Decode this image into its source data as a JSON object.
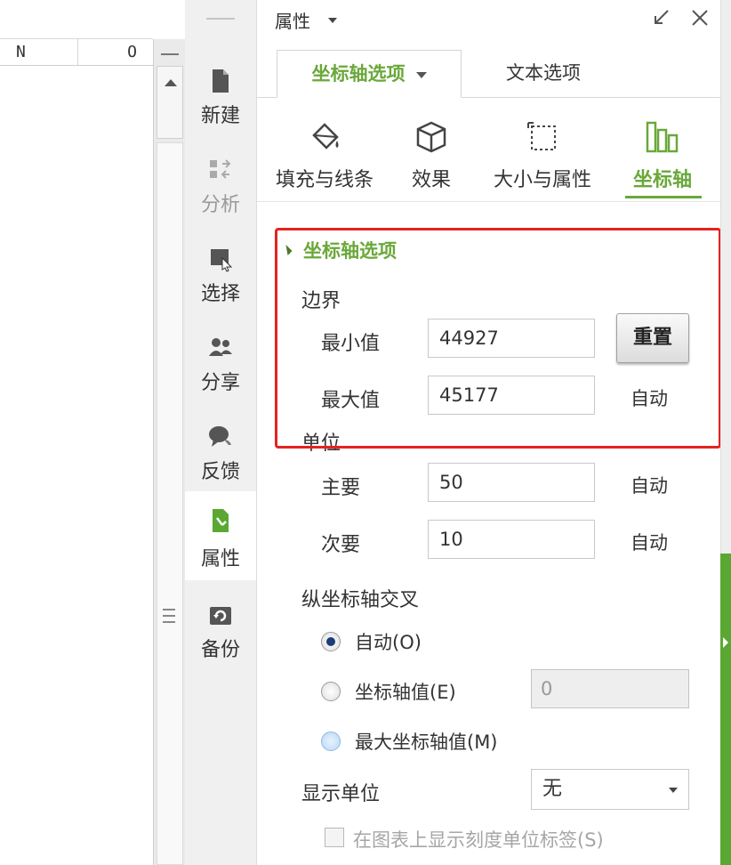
{
  "sheet": {
    "columns": [
      "N",
      "O"
    ]
  },
  "toolbar": {
    "items": [
      {
        "label": "新建",
        "icon": "new-file-icon",
        "state": "normal"
      },
      {
        "label": "分析",
        "icon": "analyze-icon",
        "state": "disabled"
      },
      {
        "label": "选择",
        "icon": "select-icon",
        "state": "normal"
      },
      {
        "label": "分享",
        "icon": "share-icon",
        "state": "normal"
      },
      {
        "label": "反馈",
        "icon": "feedback-icon",
        "state": "normal"
      },
      {
        "label": "属性",
        "icon": "properties-icon",
        "state": "active"
      },
      {
        "label": "备份",
        "icon": "backup-icon",
        "state": "normal"
      }
    ]
  },
  "pane": {
    "title": "属性",
    "tabs": {
      "axis_options": "坐标轴选项",
      "text_options": "文本选项"
    },
    "sub_tabs": {
      "fill_line": "填充与线条",
      "effect": "效果",
      "size_props": "大小与属性",
      "axis": "坐标轴"
    },
    "section_title": "坐标轴选项",
    "bounds": {
      "label": "边界",
      "min_label": "最小值",
      "min_value": "44927",
      "max_label": "最大值",
      "max_value": "45177",
      "reset_label": "重置",
      "max_state": "自动"
    },
    "units": {
      "label": "单位",
      "major_label": "主要",
      "major_value": "50",
      "major_state": "自动",
      "minor_label": "次要",
      "minor_value": "10",
      "minor_state": "自动"
    },
    "cross": {
      "label": "纵坐标轴交叉",
      "auto_label": "自动(O)",
      "value_label": "坐标轴值(E)",
      "value": "0",
      "max_label": "最大坐标轴值(M)"
    },
    "display_units": {
      "label": "显示单位",
      "selected": "无",
      "checkbox_label": "在图表上显示刻度单位标签(S)"
    }
  },
  "colors": {
    "accent_green": "#6aa83a",
    "highlight_red": "#e52320"
  }
}
